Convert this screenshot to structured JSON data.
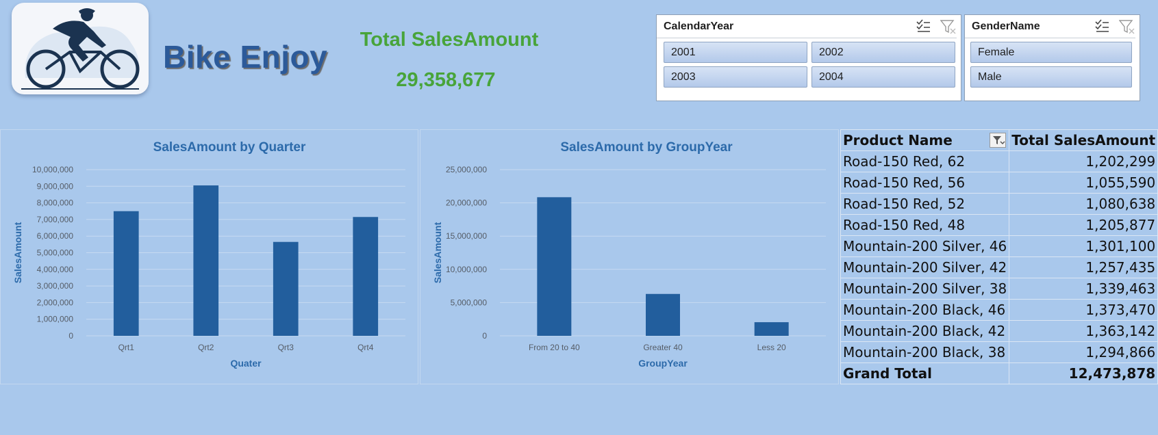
{
  "brand": {
    "title": "Bike Enjoy"
  },
  "kpi": {
    "title": "Total SalesAmount",
    "value": "29,358,677"
  },
  "slicers": [
    {
      "title": "CalendarYear",
      "items": [
        "2001",
        "2002",
        "2003",
        "2004"
      ]
    },
    {
      "title": "GenderName",
      "items": [
        "Female",
        "Male"
      ]
    }
  ],
  "chart_data": [
    {
      "type": "bar",
      "title": "SalesAmount by Quarter",
      "xlabel": "Quater",
      "ylabel": "SalesAmount",
      "categories": [
        "Qrt1",
        "Qrt2",
        "Qrt3",
        "Qrt4"
      ],
      "values": [
        7500000,
        9050000,
        5650000,
        7150000
      ],
      "ylim": [
        0,
        10000000
      ],
      "yticks": [
        0,
        1000000,
        2000000,
        3000000,
        4000000,
        5000000,
        6000000,
        7000000,
        8000000,
        9000000,
        10000000
      ],
      "ytick_labels": [
        "0",
        "1,000,000",
        "2,000,000",
        "3,000,000",
        "4,000,000",
        "5,000,000",
        "6,000,000",
        "7,000,000",
        "8,000,000",
        "9,000,000",
        "10,000,000"
      ],
      "grid": true,
      "color": "#225e9d"
    },
    {
      "type": "bar",
      "title": "SalesAmount by GroupYear",
      "xlabel": "GroupYear",
      "ylabel": "SalesAmount",
      "categories": [
        "From 20 to 40",
        "Greater 40",
        "Less 20"
      ],
      "values": [
        20850000,
        6300000,
        2050000
      ],
      "ylim": [
        0,
        25000000
      ],
      "yticks": [
        0,
        5000000,
        10000000,
        15000000,
        20000000,
        25000000
      ],
      "ytick_labels": [
        "0",
        "5,000,000",
        "10,000,000",
        "15,000,000",
        "20,000,000",
        "25,000,000"
      ],
      "grid": true,
      "color": "#225e9d"
    }
  ],
  "pivot": {
    "headers": [
      "Product Name",
      "Total SalesAmount"
    ],
    "rows": [
      [
        "Road-150 Red, 62",
        "1,202,299"
      ],
      [
        "Road-150 Red, 56",
        "1,055,590"
      ],
      [
        "Road-150 Red, 52",
        "1,080,638"
      ],
      [
        "Road-150 Red, 48",
        "1,205,877"
      ],
      [
        "Mountain-200 Silver, 46",
        "1,301,100"
      ],
      [
        "Mountain-200 Silver, 42",
        "1,257,435"
      ],
      [
        "Mountain-200 Silver, 38",
        "1,339,463"
      ],
      [
        "Mountain-200 Black, 46",
        "1,373,470"
      ],
      [
        "Mountain-200 Black, 42",
        "1,363,142"
      ],
      [
        "Mountain-200 Black, 38",
        "1,294,866"
      ]
    ],
    "total": [
      "Grand Total",
      "12,473,878"
    ]
  },
  "icons": {
    "multi_select": "multi-select-icon",
    "clear_filter": "clear-filter-icon",
    "pivot_filter": "filter-dropdown-icon"
  }
}
